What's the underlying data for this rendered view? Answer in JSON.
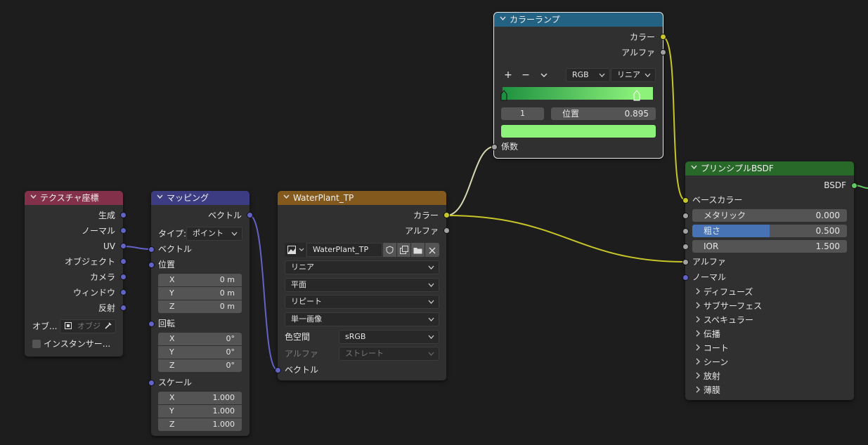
{
  "nodes": {
    "texcoord": {
      "title": "テクスチャ座標",
      "outputs": [
        "生成",
        "ノーマル",
        "UV",
        "オブジェクト",
        "カメラ",
        "ウィンドウ",
        "反射"
      ],
      "object_label": "オブ...",
      "object_placeholder": "オブジ",
      "instancer_label": "インスタンサー..."
    },
    "mapping": {
      "title": "マッピング",
      "output": "ベクトル",
      "type_label": "タイプ:",
      "type_value": "ポイント",
      "vector_label": "ベクトル",
      "location": {
        "label": "位置",
        "x": "0 m",
        "y": "0 m",
        "z": "0 m"
      },
      "rotation": {
        "label": "回転",
        "x": "0°",
        "y": "0°",
        "z": "0°"
      },
      "scale": {
        "label": "スケール",
        "x": "1.000",
        "y": "1.000",
        "z": "1.000"
      },
      "axis": {
        "x": "X",
        "y": "Y",
        "z": "Z"
      }
    },
    "image": {
      "title": "WaterPlant_TP",
      "out_color": "カラー",
      "out_alpha": "アルファ",
      "image_name": "WaterPlant_TP",
      "interpolation": "リニア",
      "projection": "平面",
      "extension": "リピート",
      "source": "単一画像",
      "colorspace_label": "色空間",
      "colorspace_value": "sRGB",
      "alpha_label": "アルファ",
      "alpha_value": "ストレート",
      "input_vector": "ベクトル"
    },
    "colorramp": {
      "title": "カラーランプ",
      "out_color": "カラー",
      "out_alpha": "アルファ",
      "add": "+",
      "remove": "−",
      "mode": "RGB",
      "interp": "リニア",
      "stop_index": "1",
      "pos_label": "位置",
      "pos_value": "0.895",
      "input_fac": "係数",
      "stop_color": "#8cf27a"
    },
    "bsdf": {
      "title": "プリンシプルBSDF",
      "output": "BSDF",
      "base_color": "ベースカラー",
      "metallic": {
        "label": "メタリック",
        "value": "0.000"
      },
      "roughness": {
        "label": "粗さ",
        "value": "0.500",
        "fill": 0.5
      },
      "ior": {
        "label": "IOR",
        "value": "1.500"
      },
      "alpha": "アルファ",
      "normal": "ノーマル",
      "panels": [
        "ディフューズ",
        "サブサーフェス",
        "スペキュラー",
        "伝播",
        "コート",
        "シーン",
        "放射",
        "薄膜"
      ]
    }
  },
  "colors": {
    "texcoord_header": "#83314a",
    "mapping_header": "#3c3c83",
    "image_header": "#83591e",
    "colorramp_header": "#246283",
    "bsdf_header": "#28692a",
    "socket_color": "#c7c729",
    "socket_float": "#a1a1a1",
    "socket_vector": "#6363c7",
    "socket_shader": "#63c763",
    "roughness_fill": "#4772b3"
  }
}
